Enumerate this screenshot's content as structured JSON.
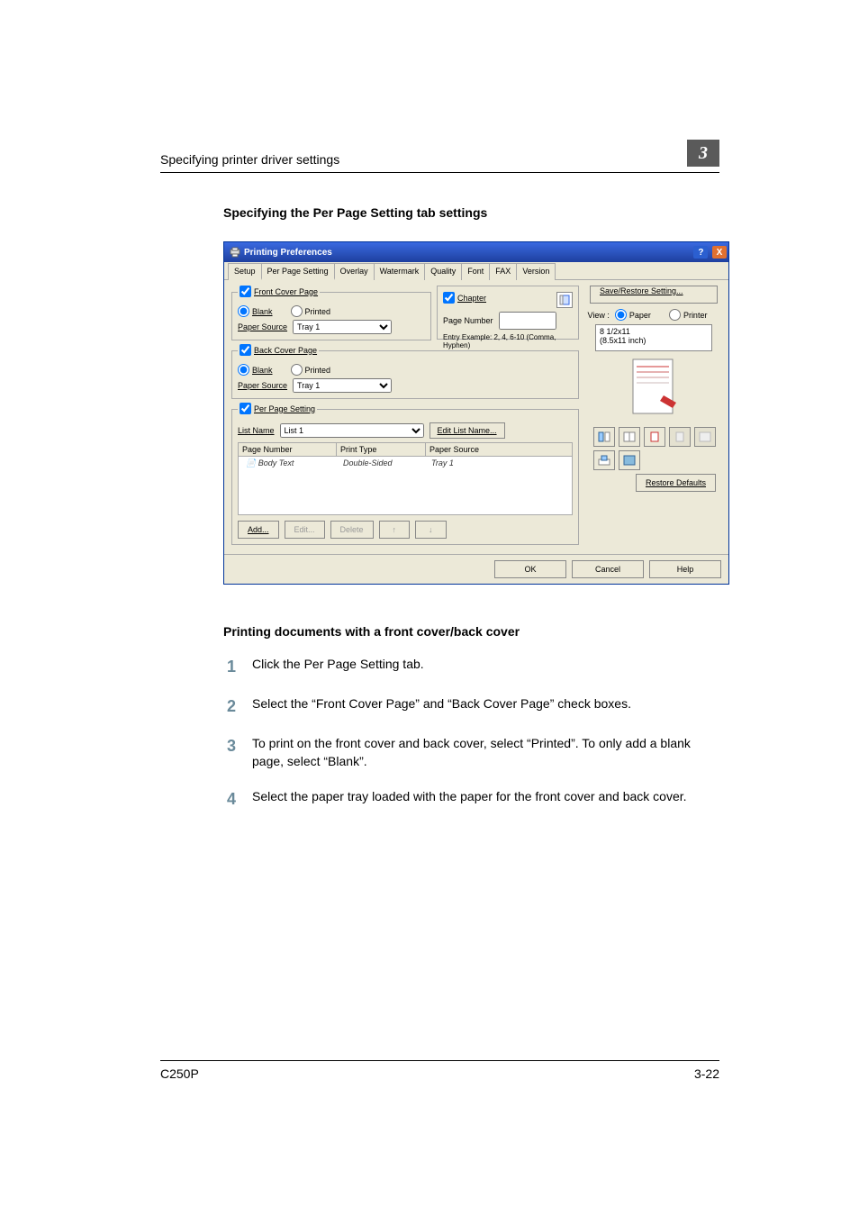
{
  "header": {
    "crumb": "Specifying printer driver settings",
    "chapter": "3"
  },
  "section_title": "Specifying the Per Page Setting tab settings",
  "dialog": {
    "title": "Printing Preferences",
    "title_icon": "printer-icon",
    "help_btn": "?",
    "close_btn": "X",
    "tabs": [
      "Setup",
      "Per Page Setting",
      "Overlay",
      "Watermark",
      "Quality",
      "Font",
      "FAX",
      "Version"
    ],
    "active_tab_index": 1,
    "front_cover": {
      "legend": "Front Cover Page",
      "checked": true,
      "blank_label": "Blank",
      "printed_label": "Printed",
      "selected": "blank",
      "paper_source_label": "Paper Source",
      "paper_source_value": "Tray 1"
    },
    "chapter": {
      "legend": "Chapter",
      "checked": true,
      "page_number_label": "Page Number",
      "page_number_value": "",
      "example": "Entry Example: 2, 4, 6-10 (Comma, Hyphen)"
    },
    "back_cover": {
      "legend": "Back Cover Page",
      "checked": true,
      "blank_label": "Blank",
      "printed_label": "Printed",
      "selected": "blank",
      "paper_source_label": "Paper Source",
      "paper_source_value": "Tray 1"
    },
    "per_page": {
      "legend": "Per Page Setting",
      "checked": true,
      "list_name_label": "List Name",
      "list_name_value": "List 1",
      "edit_list_btn": "Edit List Name...",
      "columns": [
        "Page Number",
        "Print Type",
        "Paper Source"
      ],
      "rows": [
        {
          "page": "Body Text",
          "type": "Double-Sided",
          "source": "Tray 1"
        }
      ],
      "add_btn": "Add...",
      "edit_btn": "Edit...",
      "delete_btn": "Delete",
      "up_btn": "↑",
      "down_btn": "↓"
    },
    "right": {
      "save_restore_btn": "Save/Restore Setting...",
      "view_label": "View :",
      "paper_label": "Paper",
      "printer_label": "Printer",
      "paper_size_line1": "8 1/2x11",
      "paper_size_line2": "(8.5x11 inch)",
      "restore_btn": "Restore Defaults"
    },
    "bottom": {
      "ok": "OK",
      "cancel": "Cancel",
      "help": "Help"
    }
  },
  "subhead": "Printing documents with a front cover/back cover",
  "steps": [
    "Click the Per Page Setting tab.",
    "Select the “Front Cover Page” and “Back Cover Page” check boxes.",
    "To print on the front cover and back cover, select “Printed”. To only add a blank page, select “Blank”.",
    "Select the paper tray loaded with the paper for the front cover and back cover."
  ],
  "footer": {
    "left": "C250P",
    "right": "3-22"
  }
}
